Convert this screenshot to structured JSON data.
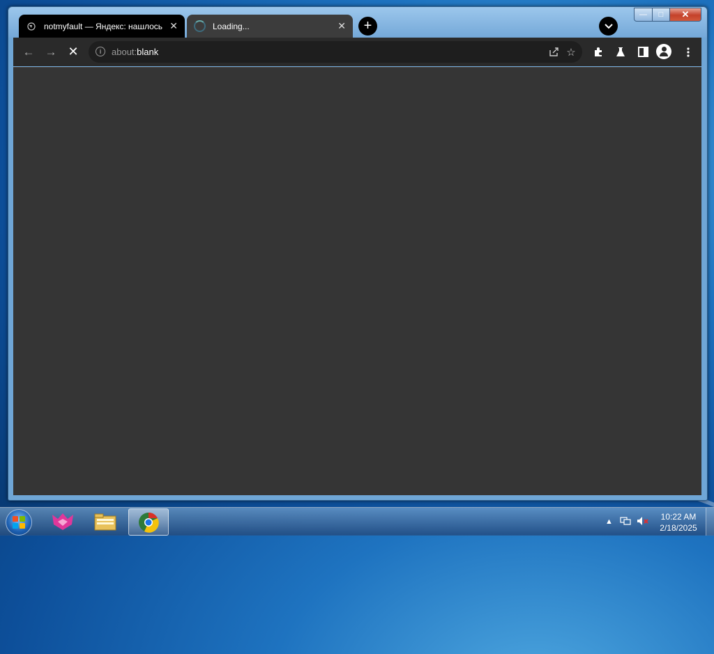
{
  "browser": {
    "tabs": [
      {
        "title": "notmyfault — Яндекс: нашлось",
        "state": "active"
      },
      {
        "title": "Loading...",
        "state": "loading"
      }
    ],
    "new_tab_label": "+",
    "tab_search_label": "⌄",
    "caption": {
      "minimize": "—",
      "maximize": "□",
      "close": "✕"
    },
    "toolbar": {
      "back": "←",
      "forward": "→",
      "stop": "✕",
      "url_scheme": "about:",
      "url_host": "blank",
      "icons": [
        "share-icon",
        "bookmark-star-icon",
        "extensions-icon",
        "labs-flask-icon",
        "side-panel-icon",
        "profile-icon",
        "menu-icon"
      ]
    },
    "content_color": "#353535"
  },
  "taskbar": {
    "pinned": [
      "start-orb",
      "stickies-app",
      "file-explorer",
      "chrome-browser"
    ],
    "tray_icons": [
      "show-hidden-icons",
      "network-icon",
      "volume-muted-icon"
    ],
    "time": "10:22 AM",
    "date": "2/18/2025"
  }
}
